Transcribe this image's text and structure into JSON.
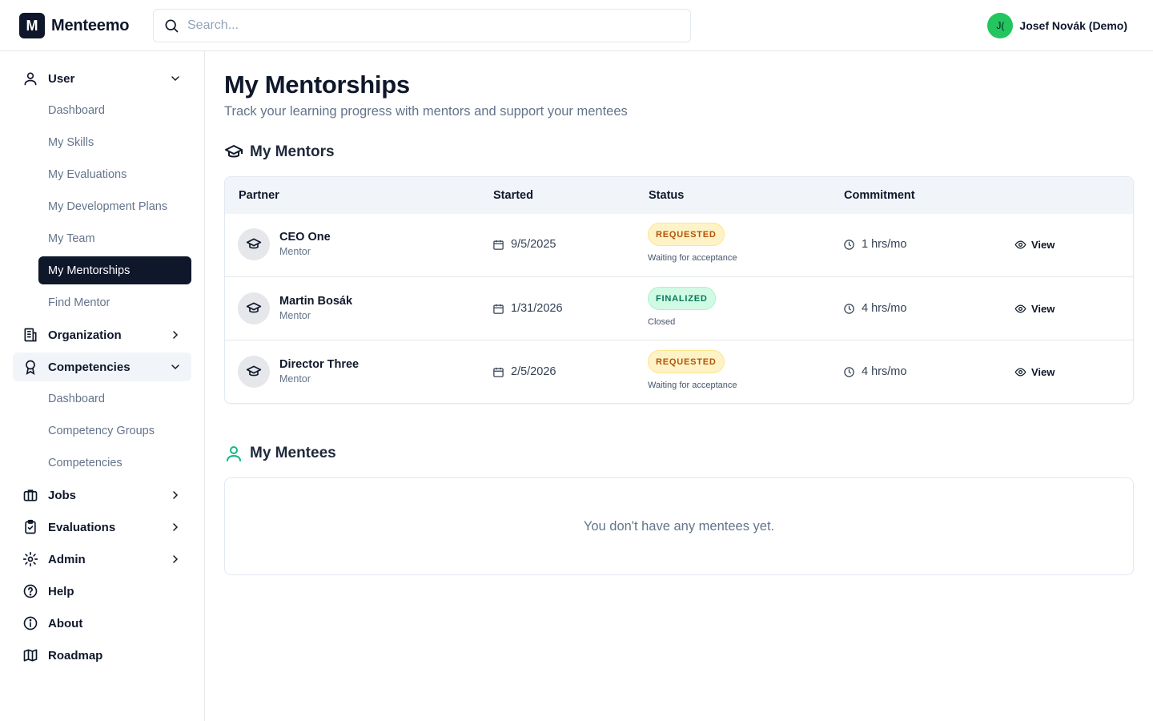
{
  "app": {
    "logo_letter": "M",
    "name": "Menteemo"
  },
  "search": {
    "placeholder": "Search..."
  },
  "user": {
    "initials": "J(",
    "name": "Josef Novák (Demo)",
    "avatar_color": "#22c55e"
  },
  "sidebar": {
    "user_group": {
      "label": "User",
      "items": [
        "Dashboard",
        "My Skills",
        "My Evaluations",
        "My Development Plans",
        "My Team",
        "My Mentorships",
        "Find Mentor"
      ]
    },
    "organization": {
      "label": "Organization"
    },
    "competencies_group": {
      "label": "Competencies",
      "items": [
        "Dashboard",
        "Competency Groups",
        "Competencies"
      ]
    },
    "jobs": {
      "label": "Jobs"
    },
    "evaluations": {
      "label": "Evaluations"
    },
    "admin": {
      "label": "Admin"
    },
    "help": {
      "label": "Help"
    },
    "about": {
      "label": "About"
    },
    "roadmap": {
      "label": "Roadmap"
    },
    "active_item": "My Mentorships"
  },
  "page": {
    "title": "My Mentorships",
    "subtitle": "Track your learning progress with mentors and support your mentees"
  },
  "mentors": {
    "title": "My Mentors",
    "columns": {
      "partner": "Partner",
      "started": "Started",
      "status": "Status",
      "commitment": "Commitment"
    },
    "rows": [
      {
        "name": "CEO One",
        "role": "Mentor",
        "started": "9/5/2025",
        "status": "REQUESTED",
        "status_note": "Waiting for acceptance",
        "commitment": "1 hrs/mo",
        "action": "View"
      },
      {
        "name": "Martin Bosák",
        "role": "Mentor",
        "started": "1/31/2026",
        "status": "FINALIZED",
        "status_note": "Closed",
        "commitment": "4 hrs/mo",
        "action": "View"
      },
      {
        "name": "Director Three",
        "role": "Mentor",
        "started": "2/5/2026",
        "status": "REQUESTED",
        "status_note": "Waiting for acceptance",
        "commitment": "4 hrs/mo",
        "action": "View"
      }
    ]
  },
  "mentees": {
    "title": "My Mentees",
    "empty_message": "You don't have any mentees yet."
  },
  "colors": {
    "primary": "#0f172a",
    "requested_bg": "#fef3c7",
    "requested_text": "#b45309",
    "finalized_bg": "#d1fae5",
    "finalized_text": "#047857",
    "mentees_icon": "#10b981"
  }
}
